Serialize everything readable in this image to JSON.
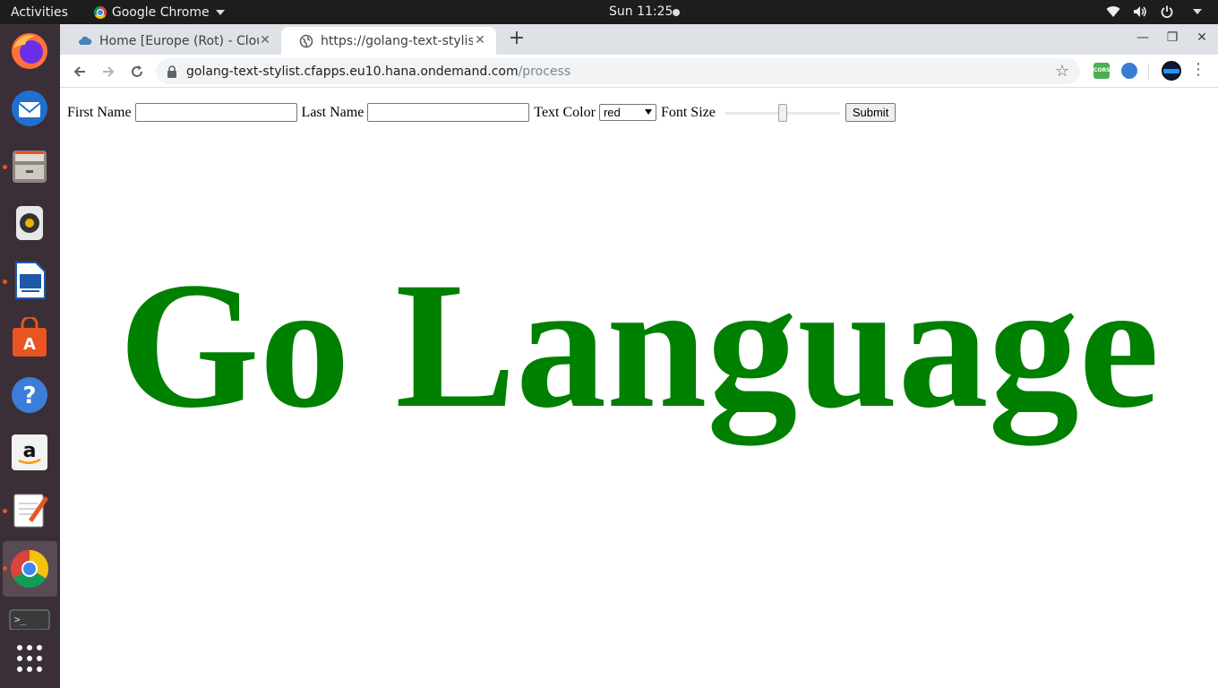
{
  "topbar": {
    "activities": "Activities",
    "app_name": "Google Chrome",
    "clock": "Sun 11:25"
  },
  "dock": {
    "items": [
      "firefox-icon",
      "thunderbird-icon",
      "files-icon",
      "rhythmbox-icon",
      "writer-icon",
      "software-center-icon",
      "help-icon",
      "amazon-icon",
      "text-editor-icon",
      "chrome-icon",
      "terminal-icon",
      "app-grid-icon"
    ]
  },
  "tabs": [
    {
      "title": "Home [Europe (Rot) - Clou",
      "close": "✕"
    },
    {
      "title": "https://golang-text-stylist",
      "close": "✕"
    }
  ],
  "new_tab": "+",
  "window_controls": {
    "minimize": "—",
    "maximize": "❐",
    "close": "✕"
  },
  "omnibox": {
    "host": "golang-text-stylist.cfapps.eu10.hana.ondemand.com",
    "path": "/process"
  },
  "extensions": {
    "cors_label": "CORS"
  },
  "form": {
    "first_name_label": "First Name",
    "first_name_value": "",
    "last_name_label": "Last Name",
    "last_name_value": "",
    "text_color_label": "Text Color",
    "text_color_selected": "red",
    "font_size_label": "Font Size",
    "font_size_fraction": 0.5,
    "submit_label": "Submit"
  },
  "output": {
    "text": "Go Language",
    "color": "#008000"
  }
}
